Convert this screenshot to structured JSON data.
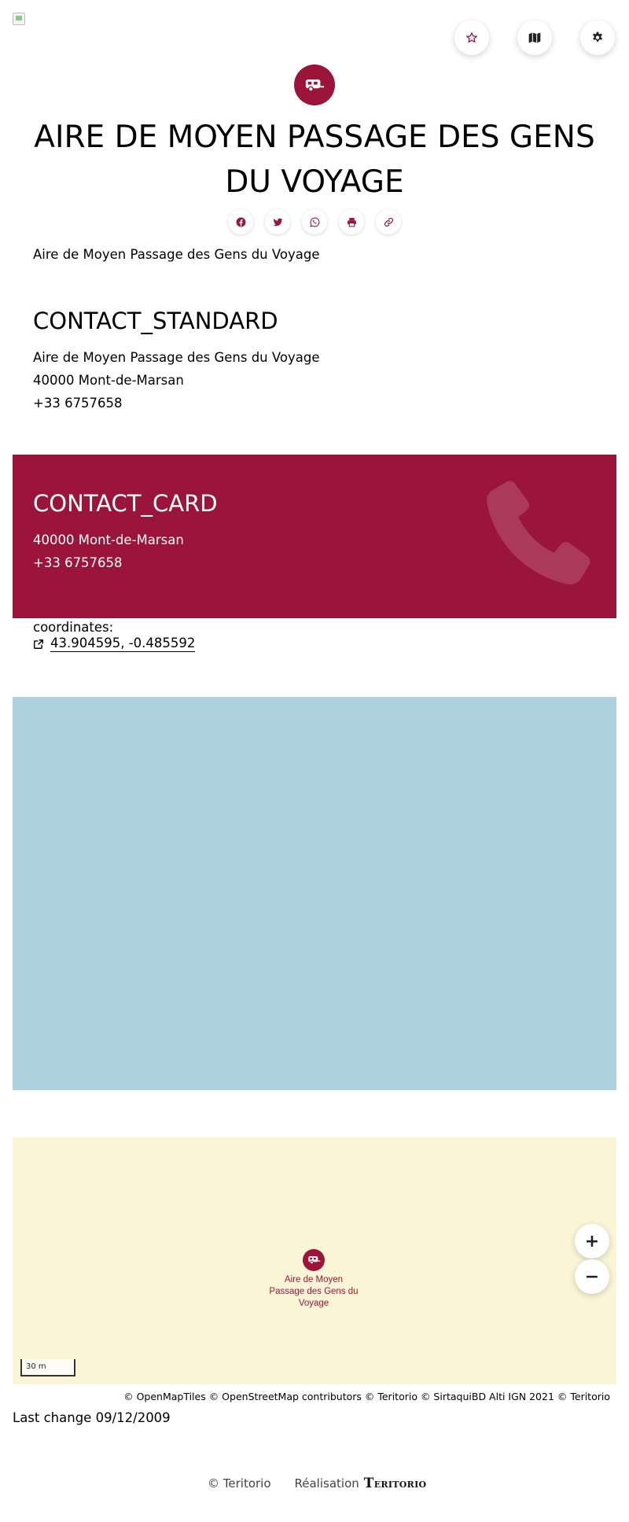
{
  "header": {
    "logo_alt": "",
    "icons": [
      "star-icon",
      "map-icon",
      "gear-icon"
    ]
  },
  "poi": {
    "category_icon": "caravan-icon",
    "title": "AIRE DE MOYEN PASSAGE DES GENS DU VOYAGE",
    "share_icons": [
      "facebook-icon",
      "twitter-icon",
      "whatsapp-icon",
      "print-icon",
      "link-icon"
    ],
    "description": "Aire de Moyen Passage des Gens du Voyage"
  },
  "contact_standard": {
    "heading": "CONTACT_STANDARD",
    "name": "Aire de Moyen Passage des Gens du Voyage",
    "postal_city": "40000 Mont-de-Marsan",
    "phone": "+33 6757658"
  },
  "contact_card": {
    "heading": "CONTACT_CARD",
    "postal_city": "40000 Mont-de-Marsan",
    "phone": "+33 6757658",
    "background_color": "#9b153a"
  },
  "coordinates": {
    "label": "coordinates:",
    "value": "43.904595, -0.485592"
  },
  "map": {
    "marker_label": "Aire de Moyen Passage des Gens du Voyage",
    "zoom_in": "+",
    "zoom_out": "−",
    "scale": "30 m",
    "attribution": "© OpenMapTiles © OpenStreetMap contributors © Teritorio © SirtaquiBD Alti IGN 2021 © Teritorio"
  },
  "last_change": "Last change 09/12/2009",
  "footer": {
    "copyright": "© Teritorio",
    "realisation": "Réalisation",
    "brand": "TERITORIO"
  },
  "colors": {
    "accent": "#9b153a",
    "water": "#abd1df",
    "land": "#faf5d6"
  }
}
